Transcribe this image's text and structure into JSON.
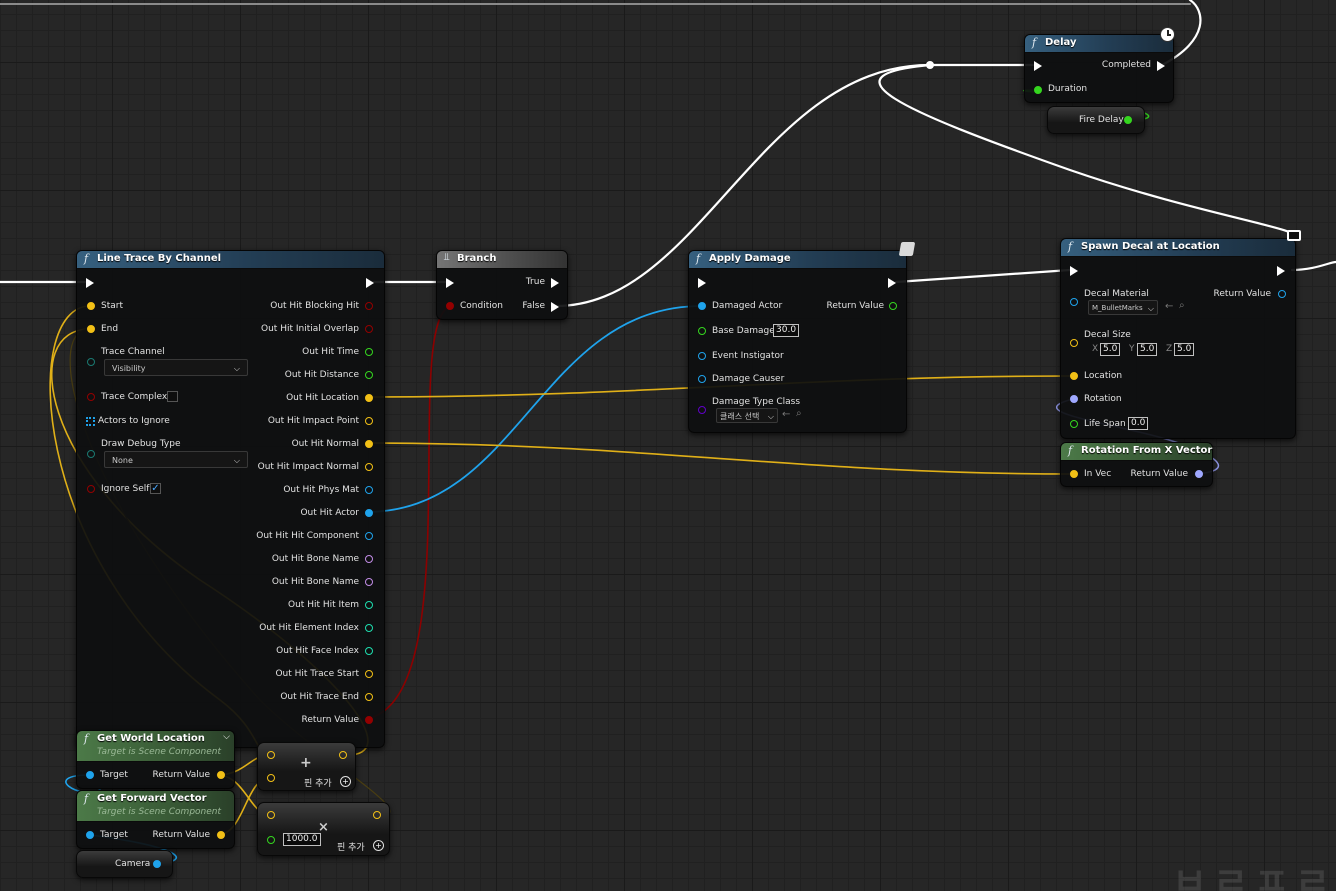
{
  "nodes": {
    "line_trace": {
      "title": "Line Trace By Channel",
      "inputs": {
        "start": "Start",
        "end": "End",
        "trace_channel": "Trace Channel",
        "trace_channel_value": "Visibility",
        "trace_complex": "Trace Complex",
        "actors_to_ignore": "Actors to Ignore",
        "draw_debug_type": "Draw Debug Type",
        "draw_debug_value": "None",
        "ignore_self": "Ignore Self"
      },
      "outputs": [
        "Out Hit Blocking Hit",
        "Out Hit Initial Overlap",
        "Out Hit Time",
        "Out Hit Distance",
        "Out Hit Location",
        "Out Hit Impact Point",
        "Out Hit Normal",
        "Out Hit Impact Normal",
        "Out Hit Phys Mat",
        "Out Hit Actor",
        "Out Hit Hit Component",
        "Out Hit Bone Name",
        "Out Hit Bone Name",
        "Out Hit Hit Item",
        "Out Hit Element Index",
        "Out Hit Face Index",
        "Out Hit Trace Start",
        "Out Hit Trace End",
        "Return Value"
      ]
    },
    "branch": {
      "title": "Branch",
      "condition": "Condition",
      "true_label": "True",
      "false_label": "False"
    },
    "apply_damage": {
      "title": "Apply Damage",
      "damaged_actor": "Damaged Actor",
      "return_value": "Return Value",
      "base_damage": "Base Damage",
      "base_damage_value": "30.0",
      "event_instigator": "Event Instigator",
      "damage_causer": "Damage Causer",
      "damage_type_class": "Damage Type Class",
      "damage_type_value": "클래스 선택"
    },
    "delay": {
      "title": "Delay",
      "completed": "Completed",
      "duration": "Duration"
    },
    "fire_delay": {
      "label": "Fire Delay"
    },
    "spawn_decal": {
      "title": "Spawn Decal at Location",
      "decal_material": "Decal Material",
      "decal_material_value": "M_BulletMarks",
      "return_value": "Return Value",
      "decal_size": "Decal Size",
      "size_x_label": "X",
      "size_x": "5.0",
      "size_y_label": "Y",
      "size_y": "5.0",
      "size_z_label": "Z",
      "size_z": "5.0",
      "location": "Location",
      "rotation": "Rotation",
      "life_span": "Life Span",
      "life_span_value": "0.0"
    },
    "rotation_from_x": {
      "title": "Rotation From X Vector",
      "in_vec": "In Vec",
      "return_value": "Return Value"
    },
    "get_world_location": {
      "title": "Get World Location",
      "subtitle": "Target is Scene Component",
      "target": "Target",
      "return_value": "Return Value"
    },
    "get_forward_vector": {
      "title": "Get Forward Vector",
      "subtitle": "Target is Scene Component",
      "target": "Target",
      "return_value": "Return Value"
    },
    "camera": {
      "label": "Camera"
    },
    "add_node": {
      "symbol": "+",
      "add_pin": "핀 추가"
    },
    "multiply_node": {
      "symbol": "×",
      "value": "1000.0",
      "add_pin": "핀 추가"
    }
  },
  "colors": {
    "exec": "#ffffff",
    "bool": "#930000",
    "float": "#35d61f",
    "vector": "#f2c016",
    "object": "#1fa3ec",
    "struct": "#0085a8",
    "name": "#c28de6",
    "int": "#1edeaf",
    "rotator": "#9fa8ff",
    "class": "#6000c8",
    "panel_bg": "#262626"
  },
  "watermark": "ㅂㄹㅍㄹ"
}
